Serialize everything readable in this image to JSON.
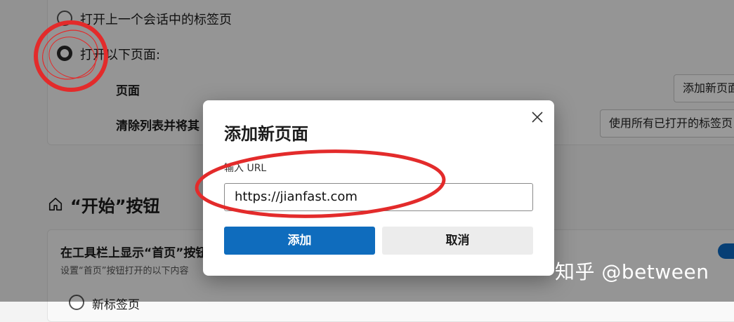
{
  "settings": {
    "option_last_session": "打开上一个会话中的标签页",
    "option_specific_pages": "打开以下页面:",
    "pages_label": "页面",
    "add_new_page_button": "添加新页面",
    "clear_list_label": "清除列表并将其",
    "use_open_tabs_button": "使用所有已打开的标签页",
    "start_button_section_title": "“开始”按钮",
    "show_home_button_label": "在工具栏上显示“首页”按钮",
    "show_home_button_desc": "设置“首页”按钮打开的以下内容",
    "new_tab_option": "新标签页"
  },
  "dialog": {
    "title": "添加新页面",
    "url_label": "输入 URL",
    "url_value": "https://jianfast.com",
    "add_button": "添加",
    "cancel_button": "取消",
    "close_icon": "close-icon"
  },
  "watermark": "知乎 @between",
  "colors": {
    "accent": "#0f6cbd",
    "annotation": "#e32b2b",
    "toggle_on": "#0d6ac4"
  }
}
